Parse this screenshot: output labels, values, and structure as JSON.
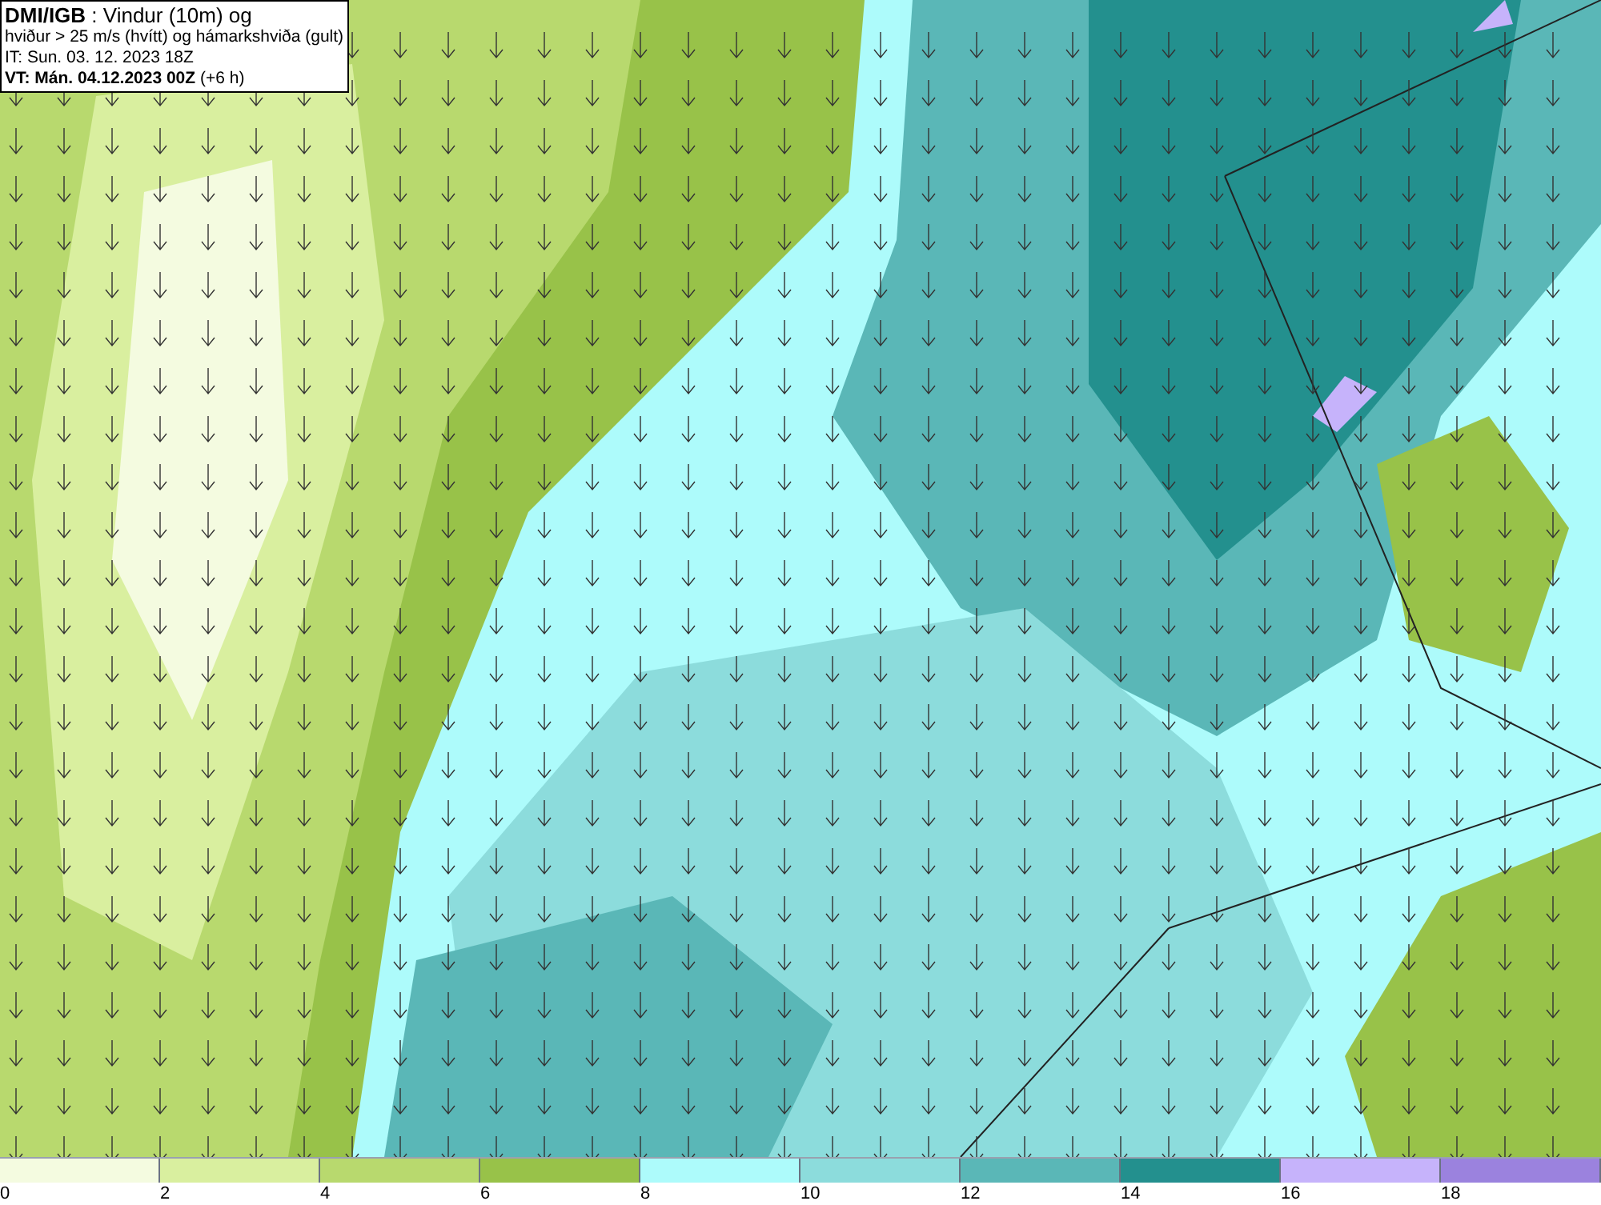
{
  "title_box": {
    "lines": [
      "**DMI/IGB** : Vindur (10m) og",
      "hviður > 25 m/s (hvítt) og hámarkshviða (gult)",
      "IT: Sun. 03. 12. 2023 18Z",
      "**VT: Mán. 04.12.2023 00Z** (+6 h)"
    ]
  },
  "legend": [
    {
      "label": "0",
      "color": "#f4fbe0"
    },
    {
      "label": "2",
      "color": "#d9ef9f"
    },
    {
      "label": "4",
      "color": "#b8d96e"
    },
    {
      "label": "6",
      "color": "#98c249"
    },
    {
      "label": "8",
      "color": "#adfbfb"
    },
    {
      "label": "10",
      "color": "#8cdcdc"
    },
    {
      "label": "12",
      "color": "#5ab7b7"
    },
    {
      "label": "14",
      "color": "#23908e"
    },
    {
      "label": "16",
      "color": "#c6b3fb"
    },
    {
      "label": "18",
      "color": "#9b82de"
    }
  ]
}
